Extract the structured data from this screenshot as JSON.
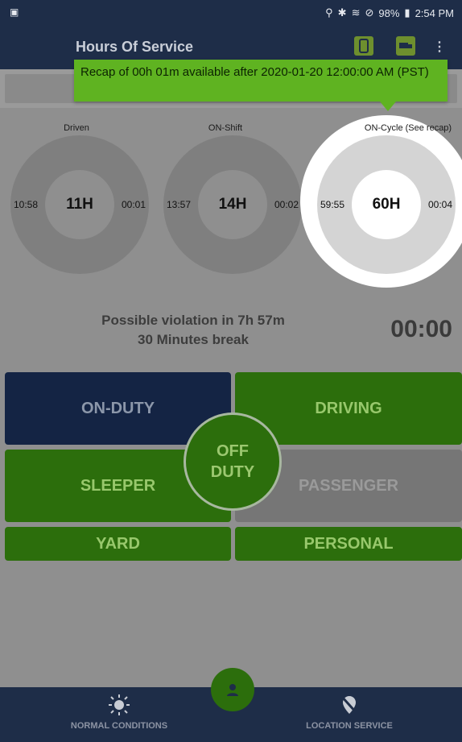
{
  "status_bar": {
    "battery": "98%",
    "time": "2:54 PM"
  },
  "app_bar": {
    "title": "Hours Of Service"
  },
  "tooltip": {
    "text": "Recap of 00h 01m available after 2020-01-20 12:00:00 AM (PST)"
  },
  "gauges": [
    {
      "label": "Driven",
      "center": "11H",
      "left": "10:58",
      "right": "00:01"
    },
    {
      "label": "ON-Shift",
      "center": "14H",
      "left": "13:57",
      "right": "00:02"
    },
    {
      "label": "ON-Cycle (See recap)",
      "center": "60H",
      "left": "59:55",
      "right": "00:04"
    }
  ],
  "violation": {
    "line1": "Possible violation in 7h 57m",
    "line2": "30 Minutes break"
  },
  "timer": "00:00",
  "duty_buttons": {
    "on_duty": "ON-DUTY",
    "driving": "DRIVING",
    "sleeper": "SLEEPER",
    "passenger": "PASSENGER",
    "yard": "YARD",
    "personal": "PERSONAL",
    "off_duty_line1": "OFF",
    "off_duty_line2": "DUTY"
  },
  "bottom_nav": {
    "left_label": "NORMAL CONDITIONS",
    "right_label": "LOCATION SERVICE"
  },
  "colors": {
    "navy": "#1e2d48",
    "green": "#2c6e0c",
    "tooltip_green": "#5fb321"
  }
}
